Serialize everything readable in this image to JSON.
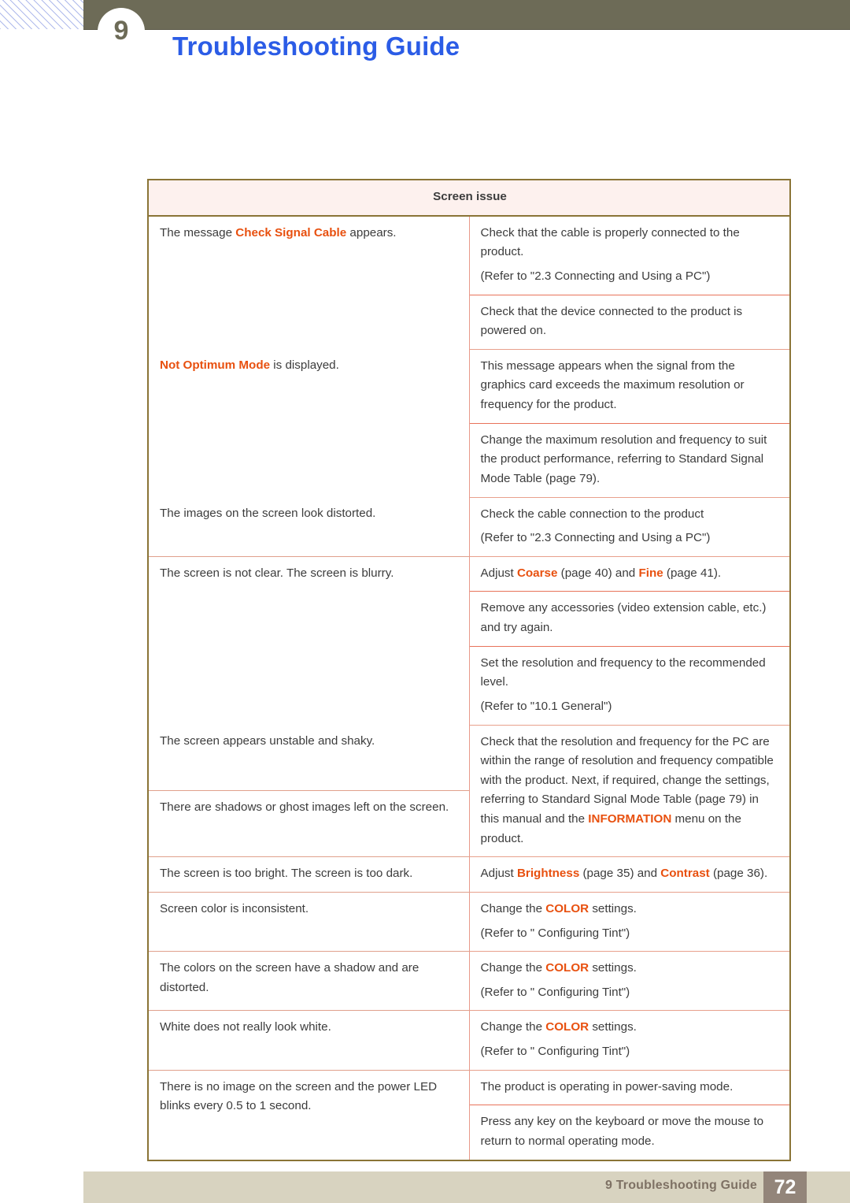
{
  "header": {
    "chapter_number": "9",
    "title": "Troubleshooting Guide"
  },
  "table": {
    "header": "Screen issue",
    "rows": [
      {
        "issue_parts": [
          {
            "t": "The message ",
            "k": false
          },
          {
            "t": "Check Signal Cable",
            "k": true
          },
          {
            "t": " appears.",
            "k": false
          }
        ],
        "solutions": [
          [
            "Check that the cable is properly connected to the product.",
            "(Refer to \"2.3 Connecting and Using a PC\")"
          ],
          [
            "Check that the device connected to the product is powered on."
          ]
        ]
      },
      {
        "issue_parts": [
          {
            "t": "Not Optimum Mode",
            "k": true
          },
          {
            "t": " is displayed.",
            "k": false
          }
        ],
        "solutions": [
          [
            "This message appears when the signal from the graphics card exceeds the maximum resolution or frequency for the product."
          ],
          [
            "Change the maximum resolution and frequency to suit the product performance, referring to Standard Signal Mode Table (page 79)."
          ]
        ]
      },
      {
        "issue_parts": [
          {
            "t": "The images on the screen look distorted.",
            "k": false
          }
        ],
        "solutions": [
          [
            "Check the cable connection to the product",
            "(Refer to \"2.3 Connecting and Using a PC\")"
          ]
        ]
      },
      {
        "issue_parts": [
          {
            "t": "The screen is not clear. The screen is blurry.",
            "k": false
          }
        ],
        "solutions": [
          [
            {
              "parts": [
                {
                  "t": "Adjust ",
                  "k": false
                },
                {
                  "t": "Coarse",
                  "k": true
                },
                {
                  "t": " (page 40) and ",
                  "k": false
                },
                {
                  "t": "Fine",
                  "k": true
                },
                {
                  "t": " (page 41).",
                  "k": false
                }
              ]
            }
          ],
          [
            "Remove any accessories (video extension cable, etc.) and try again."
          ],
          [
            "Set the resolution and frequency to the recommended level.",
            "(Refer to \"10.1 General\")"
          ]
        ]
      },
      {
        "issue_parts": [
          {
            "t": "The screen appears unstable and shaky.",
            "k": false
          }
        ],
        "issue_parts_2": [
          {
            "t": "There are shadows or ghost images left on the screen.",
            "k": false
          }
        ],
        "solutions": [
          [
            {
              "parts": [
                {
                  "t": "Check that the resolution and frequency for the PC are within the range of resolution and frequency compatible with the product. Next, if required, change the settings, referring to Standard Signal Mode Table (page 79) in this manual and the ",
                  "k": false
                },
                {
                  "t": "INFORMATION",
                  "k": true
                },
                {
                  "t": " menu on the product.",
                  "k": false
                }
              ]
            }
          ]
        ]
      },
      {
        "issue_parts": [
          {
            "t": "The screen is too bright. The screen is too dark.",
            "k": false
          }
        ],
        "solutions": [
          [
            {
              "parts": [
                {
                  "t": "Adjust ",
                  "k": false
                },
                {
                  "t": "Brightness",
                  "k": true
                },
                {
                  "t": " (page 35) and ",
                  "k": false
                },
                {
                  "t": "Contrast",
                  "k": true
                },
                {
                  "t": " (page 36).",
                  "k": false
                }
              ]
            }
          ]
        ]
      },
      {
        "issue_parts": [
          {
            "t": "Screen color is inconsistent.",
            "k": false
          }
        ],
        "solutions": [
          [
            {
              "parts": [
                {
                  "t": "Change the ",
                  "k": false
                },
                {
                  "t": "COLOR",
                  "k": true
                },
                {
                  "t": " settings.",
                  "k": false
                }
              ]
            },
            "(Refer to \" Configuring Tint\")"
          ]
        ]
      },
      {
        "issue_parts": [
          {
            "t": "The colors on the screen have a shadow and are distorted.",
            "k": false
          }
        ],
        "solutions": [
          [
            {
              "parts": [
                {
                  "t": "Change the ",
                  "k": false
                },
                {
                  "t": "COLOR",
                  "k": true
                },
                {
                  "t": " settings.",
                  "k": false
                }
              ]
            },
            "(Refer to \" Configuring Tint\")"
          ]
        ]
      },
      {
        "issue_parts": [
          {
            "t": "White does not really look white.",
            "k": false
          }
        ],
        "solutions": [
          [
            {
              "parts": [
                {
                  "t": "Change the ",
                  "k": false
                },
                {
                  "t": "COLOR",
                  "k": true
                },
                {
                  "t": " settings.",
                  "k": false
                }
              ]
            },
            "(Refer to \" Configuring Tint\")"
          ]
        ]
      },
      {
        "issue_parts": [
          {
            "t": "There is no image on the screen and the power LED blinks every 0.5 to 1 second.",
            "k": false
          }
        ],
        "solutions": [
          [
            "The product is operating in power-saving mode."
          ],
          [
            "Press any key on the keyboard or move the mouse to return to normal operating mode."
          ]
        ]
      }
    ]
  },
  "footer": {
    "label": "9 Troubleshooting Guide",
    "page_number": "72"
  },
  "colors": {
    "title_blue": "#2b5ce6",
    "keyword_orange": "#e8500f",
    "header_olive": "#6d6b57",
    "table_header_text": "#7a5e16",
    "footer_beige": "#d8d3c0",
    "footer_page_box": "#93857a"
  }
}
